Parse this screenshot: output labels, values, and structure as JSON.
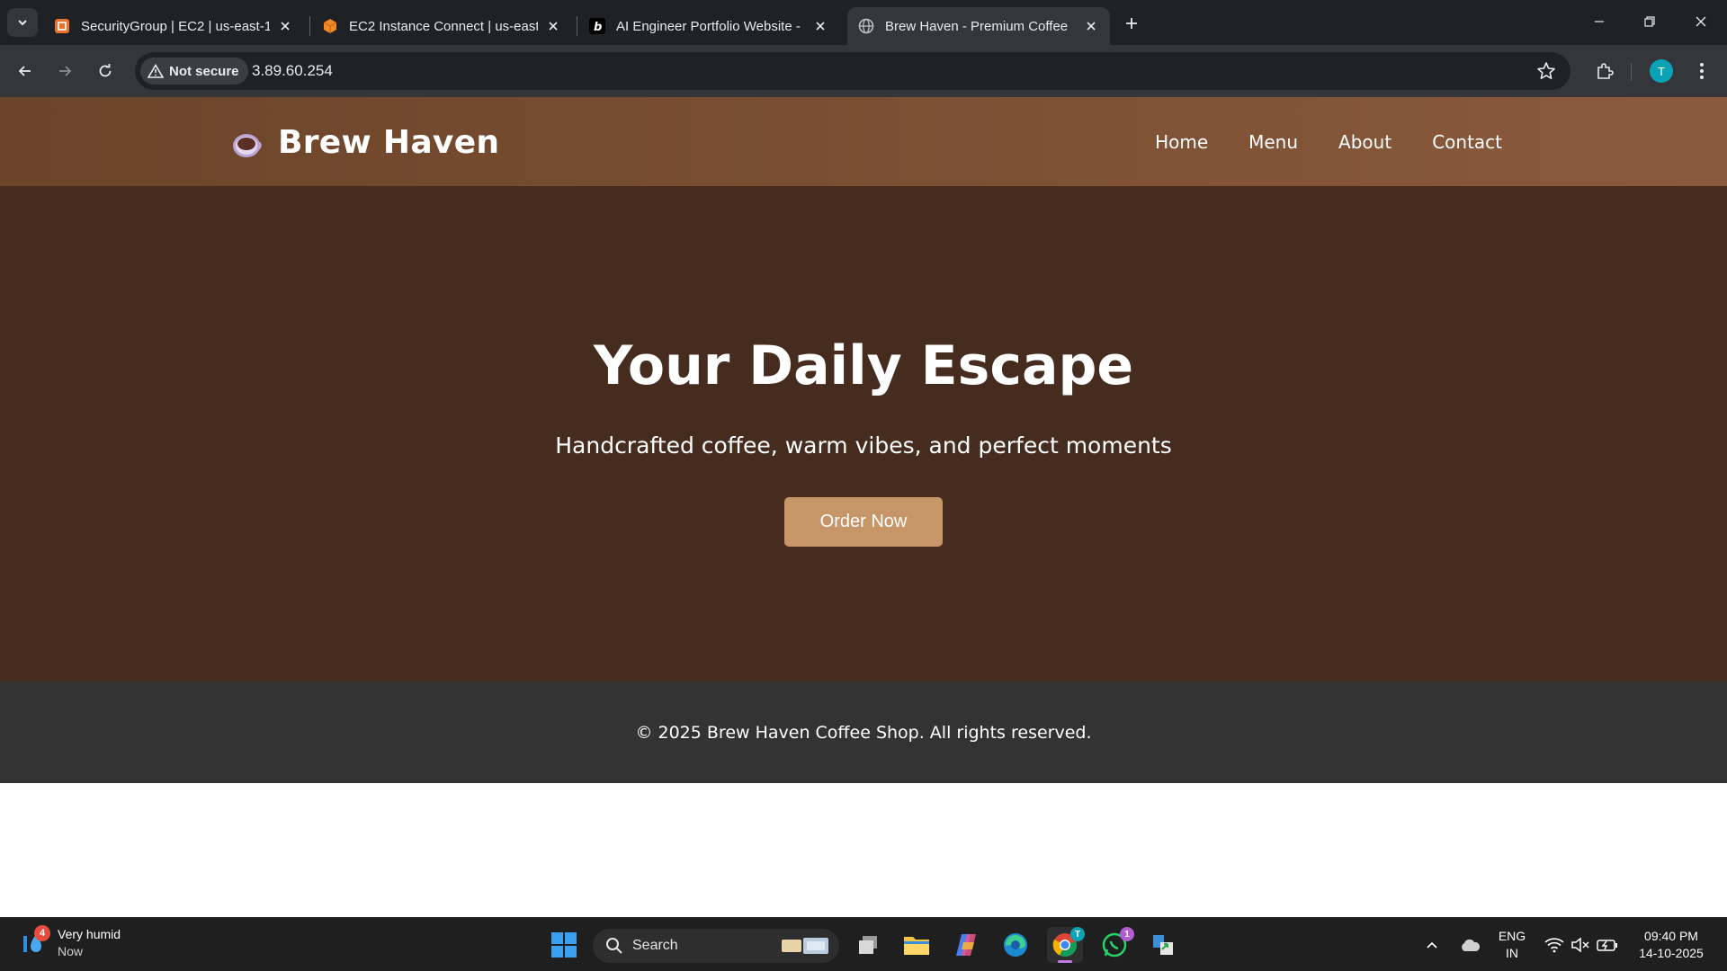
{
  "browser": {
    "tabs": [
      {
        "title": "SecurityGroup | EC2 | us-east-1",
        "icon": "aws-ec2-icon"
      },
      {
        "title": "EC2 Instance Connect | us-east-",
        "icon": "aws-cube-icon"
      },
      {
        "title": "AI Engineer Portfolio Website -",
        "icon": "bold-b-icon"
      },
      {
        "title": "Brew Haven - Premium Coffee",
        "icon": "globe-icon",
        "active": true
      }
    ],
    "security_label": "Not secure",
    "url": "3.89.60.254",
    "profile_initial": "T"
  },
  "site": {
    "logo_text": "Brew Haven",
    "nav": [
      "Home",
      "Menu",
      "About",
      "Contact"
    ],
    "hero": {
      "title": "Your Daily Escape",
      "subtitle": "Handcrafted coffee, warm vibes, and perfect moments",
      "cta": "Order Now"
    },
    "footer": "© 2025 Brew Haven Coffee Shop. All rights reserved.",
    "colors": {
      "header": "#7a4f33",
      "hero_bg": "#452c1f",
      "cta": "#c69668",
      "footer_bg": "#333333"
    }
  },
  "taskbar": {
    "weather": {
      "title": "Very humid",
      "sub": "Now",
      "badge": "4"
    },
    "search_label": "Search",
    "whatsapp_badge": "1",
    "chrome_badge": "T",
    "language": {
      "line1": "ENG",
      "line2": "IN"
    },
    "clock": {
      "time": "09:40 PM",
      "date": "14-10-2025"
    }
  }
}
